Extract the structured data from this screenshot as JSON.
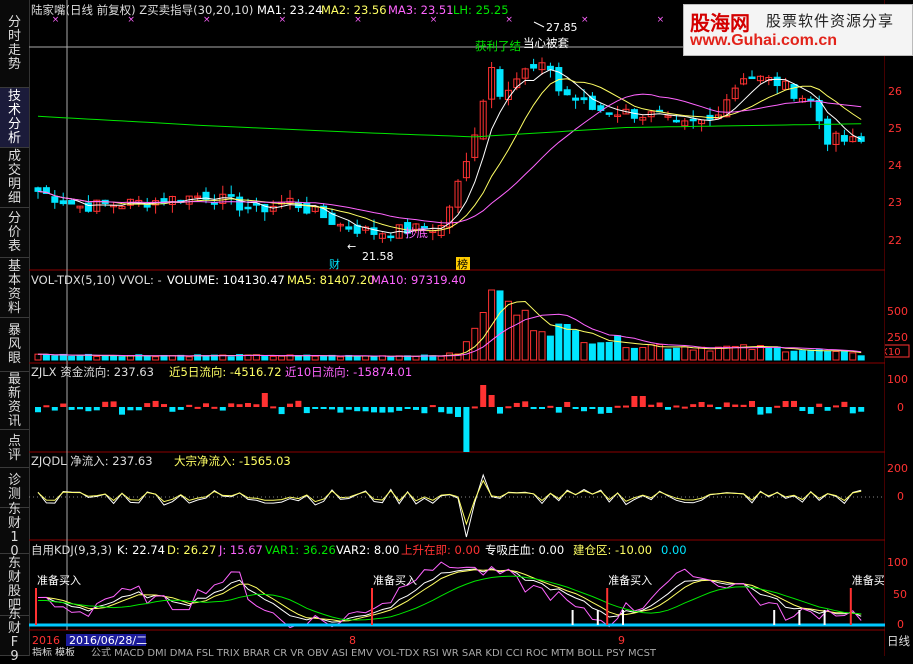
{
  "sidebar": {
    "items": [
      {
        "label": "分时走势",
        "active": false
      },
      {
        "label": "技术分析",
        "active": true
      },
      {
        "label": "成交明细",
        "active": false
      },
      {
        "label": "分价表",
        "active": false
      },
      {
        "label": "基本资料",
        "active": false
      },
      {
        "label": "暴风眼",
        "active": false
      },
      {
        "label": "最新资讯",
        "active": false
      },
      {
        "label": "点评",
        "active": false
      },
      {
        "label": "诊测",
        "active": false
      },
      {
        "label": "东财10",
        "active": false
      },
      {
        "label": "东财股吧",
        "active": false
      },
      {
        "label": "东财F9",
        "active": false
      }
    ]
  },
  "main": {
    "title": "陆家嘴(日线 前复权) Z买卖指导(30,20,10)",
    "ma1": "MA1: 23.24",
    "ma2": "MA2: 23.56",
    "ma3": "MA3: 23.51",
    "lh": "LH: 25.25",
    "high_label": "27.85",
    "low_label": "21.58",
    "ann_profit": "获利了结",
    "ann_careful": "当心被套",
    "ann_bottom": "抄底",
    "ann_cai": "财",
    "ann_bang": "榜",
    "price_ticks": [
      "26",
      "25",
      "24",
      "23",
      "22"
    ]
  },
  "volume": {
    "name": "VOL-TDX(5,10)  VVOL: -",
    "volume": "VOLUME: 104130.47",
    "ma5": "MA5: 81407.20",
    "ma10": "MA10: 97319.40",
    "ticks": [
      "500",
      "250"
    ],
    "unit": "X10"
  },
  "zjlx": {
    "name": "ZJLX 资金流向: 237.63",
    "f5": "近5日流向: -4516.72",
    "f10": "近10日流向: -15874.01",
    "ticks": [
      "100",
      "0"
    ]
  },
  "zjqdl": {
    "name": "ZJQDL  净流入: 237.63",
    "bulk": "大宗净流入: -1565.03",
    "ticks": [
      "200",
      "0"
    ]
  },
  "kdj": {
    "name": "自用KDJ(9,3,3)",
    "k": "K: 22.74",
    "d": "D: 26.27",
    "j": "J: 15.67",
    "var1": "VAR1: 36.26",
    "var2": "VAR2: 8.00",
    "up": "上升在即: 0.00",
    "absorb": "专吸庄血: 0.00",
    "build": "建仓区: -10.00",
    "last": "0.00",
    "signal": "准备买入",
    "ticks": [
      "100",
      "50",
      "0"
    ]
  },
  "timeline": {
    "year": "2016",
    "date": "2016/06/28/二",
    "m8": "8",
    "m9": "9",
    "period": "日线"
  },
  "tabs": {
    "label": "指标 模板",
    "items": "公式 MACD DMI DMA FSL TRIX BRAR CR VR OBV ASI EMV VOL-TDX RSI WR SAR KDJ CCI ROC MTM BOLL PSY MCST"
  },
  "logo": {
    "brand": "股海网",
    "slogan": "股票软件资源分享",
    "url": "www.Guhai.com.cn"
  },
  "colors": {
    "up": "#ff3232",
    "down": "#00e5ff",
    "ma1": "#ffffff",
    "ma2": "#ffff64",
    "ma3": "#ff64ff",
    "lh": "#00e600",
    "grid": "#8b0000"
  }
}
